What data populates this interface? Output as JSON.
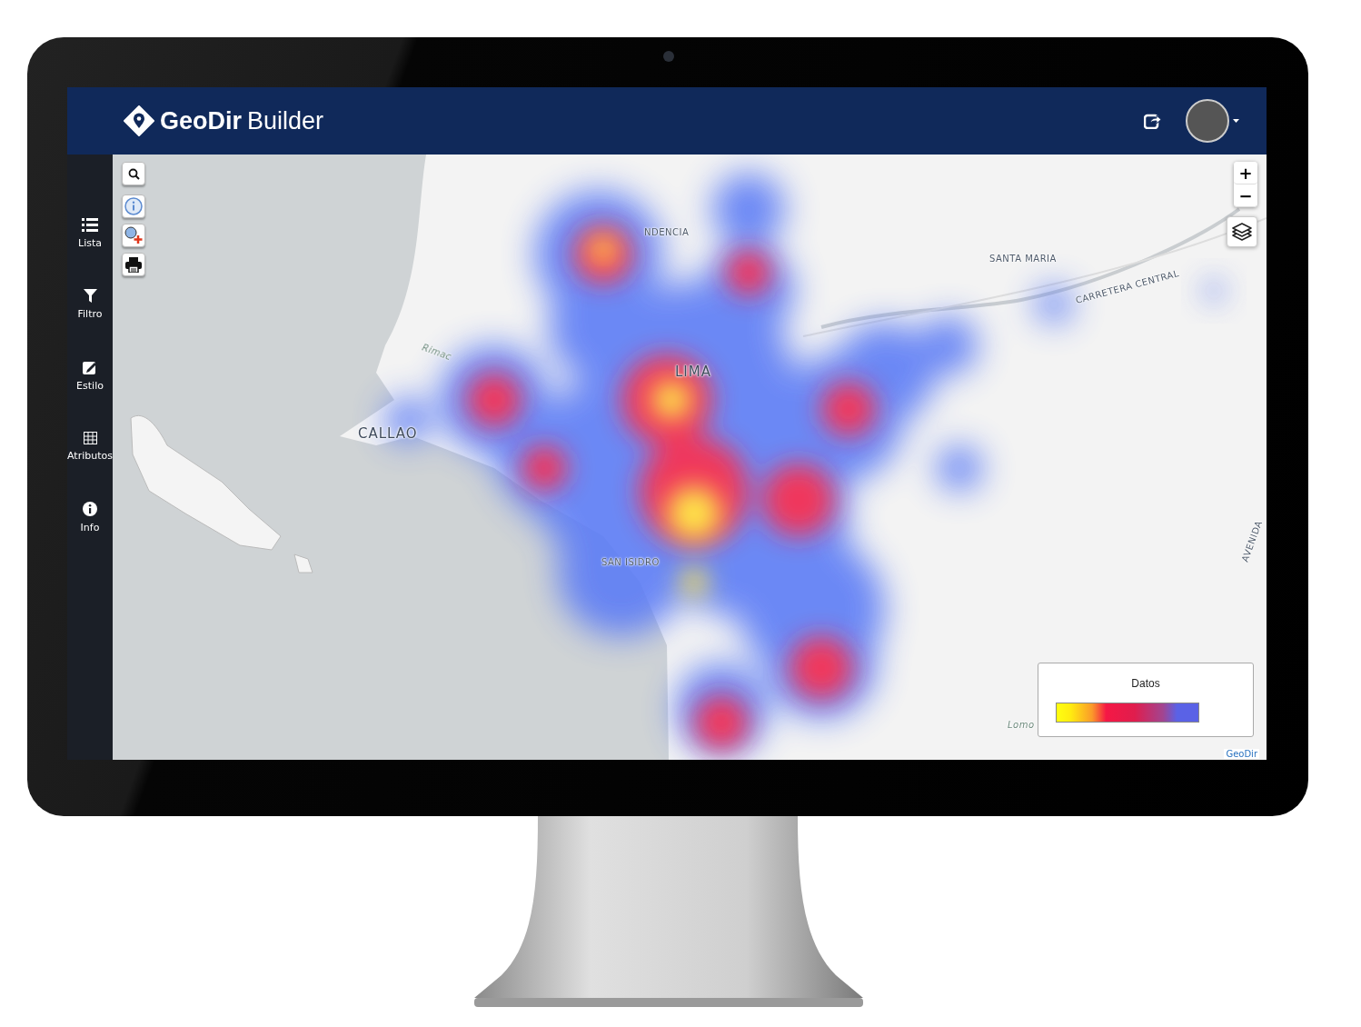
{
  "app": {
    "brand_bold": "GeoDir",
    "brand_light": "Builder"
  },
  "sidebar": {
    "items": [
      {
        "kind": "list",
        "label": "Lista"
      },
      {
        "kind": "filter",
        "label": "Filtro"
      },
      {
        "kind": "style",
        "label": "Estilo"
      },
      {
        "kind": "table",
        "label": "Atributos"
      },
      {
        "kind": "info",
        "label": "Info"
      }
    ]
  },
  "map": {
    "tools": [
      {
        "kind": "search"
      },
      {
        "kind": "info"
      },
      {
        "kind": "zoom_add"
      },
      {
        "kind": "print"
      }
    ],
    "zoom": [
      "+",
      "−"
    ],
    "labels": [
      {
        "text": "NDENCIA",
        "kind": "district"
      },
      {
        "text": "SANTA MARIA",
        "kind": "district"
      },
      {
        "text": "CARRETERA CENTRAL",
        "kind": "road"
      },
      {
        "text": "Rimac",
        "kind": "river"
      },
      {
        "text": "LIMA",
        "kind": "city"
      },
      {
        "text": "CALLAO",
        "kind": "city"
      },
      {
        "text": "SAN ISIDRO",
        "kind": "district"
      },
      {
        "text": "AVENIDA",
        "kind": "road"
      },
      {
        "text": "Lomo",
        "kind": "river"
      }
    ],
    "legend": {
      "title": "Datos"
    },
    "attribution": "GeoDir"
  }
}
